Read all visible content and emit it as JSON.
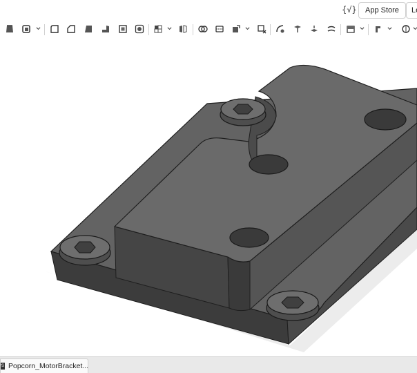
{
  "header": {
    "variables_icon": "{√}",
    "app_store_label": "App Store",
    "learning_label": "Le"
  },
  "toolbar": {
    "tools": [
      "extrude-icon",
      "revolve-icon",
      "fillet-icon",
      "chamfer-icon",
      "draft-icon",
      "rib-icon",
      "shell-icon",
      "hole-icon",
      "linear-pattern-icon",
      "mirror-icon",
      "boolean-icon",
      "split-icon",
      "transform-icon",
      "delete-part-icon",
      "modify-fillet-icon",
      "move-face-icon",
      "replace-face-icon",
      "offset-surface-icon",
      "plane-icon",
      "mate-connector-icon",
      "measure-icon"
    ]
  },
  "bottom": {
    "document_tab_label": "Popcorn_MotorBracket...",
    "document_tab_icon": "part-studio-icon"
  },
  "colors": {
    "part_body": "#5c5c5c",
    "part_top_face": "#676767",
    "part_dark_side": "#3e3e3e",
    "edges": "#1f1f1f",
    "background": "#ffffff"
  }
}
